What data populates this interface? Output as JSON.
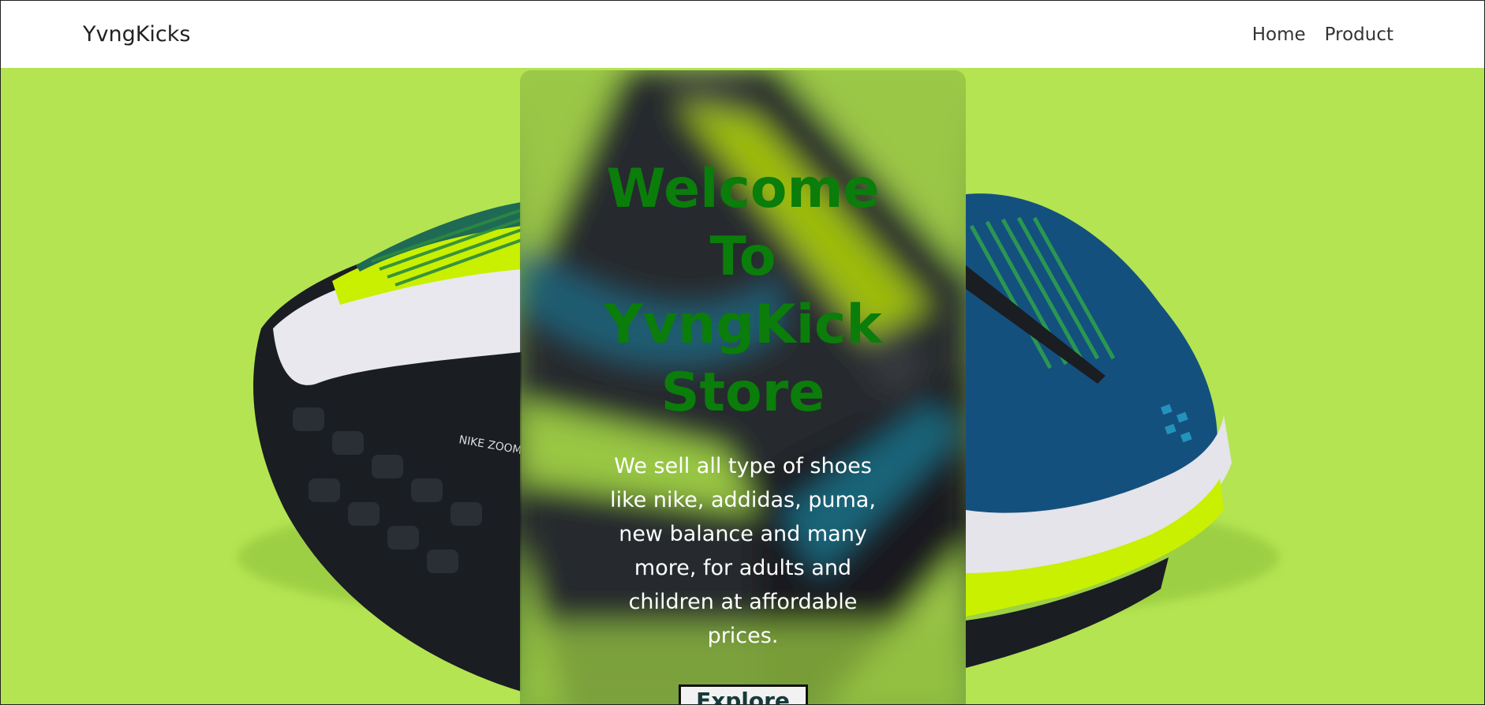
{
  "navbar": {
    "brand": "YvngKicks",
    "links": [
      "Home",
      "Product"
    ]
  },
  "hero": {
    "title": "Welcome To YvngKick Store",
    "description": "We sell all type of shoes like nike, addidas, puma, new balance and many more, for adults and children at affordable prices.",
    "button_label": "Explore",
    "shoe_print": "NIKE ZOOM"
  },
  "colors": {
    "background": "#b4e452",
    "navbar": "#ffffff",
    "title": "#0a7d0a",
    "shoe_blue": "#14507e",
    "shoe_volt": "#c8f000"
  }
}
